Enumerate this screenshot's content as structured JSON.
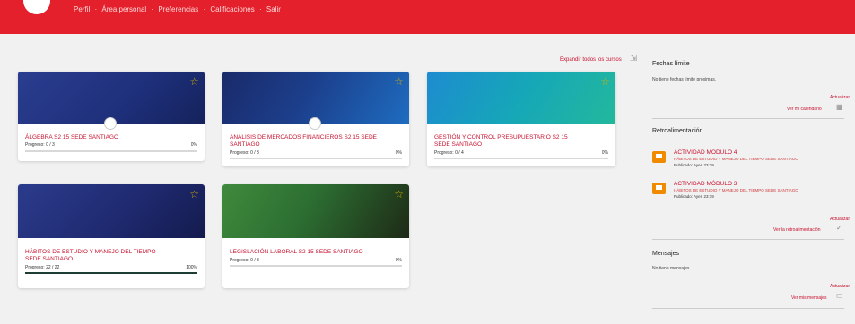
{
  "header": {
    "breadcrumbs": [
      "Perfil",
      "Área personal",
      "Preferencias",
      "Calificaciones",
      "Salir"
    ],
    "separator": "·"
  },
  "main": {
    "expand_label": "Expandir todos los cursos",
    "courses": [
      {
        "title": "ÁLGEBRA S2 15 SEDE SANTIAGO",
        "progress_label": "Progreso: 0 / 3",
        "percent_text": "0%",
        "percent": 0
      },
      {
        "title": "ANÁLISIS DE MERCADOS FINANCIEROS S2 15 SEDE SANTIAGO",
        "progress_label": "Progreso: 0 / 3",
        "percent_text": "0%",
        "percent": 0
      },
      {
        "title": "GESTIÓN Y CONTROL PRESUPUESTARIO S2 15 SEDE SANTIAGO",
        "progress_label": "Progreso: 0 / 4",
        "percent_text": "0%",
        "percent": 0
      },
      {
        "title": "HÁBITOS DE ESTUDIO Y MANEJO DEL TIEMPO SEDE SANTIAGO",
        "progress_label": "Progreso: 22 / 22",
        "percent_text": "100%",
        "percent": 100
      },
      {
        "title": "LEGISLACIÓN LABORAL S2 15 SEDE SANTIAGO",
        "progress_label": "Progreso: 0 / 3",
        "percent_text": "0%",
        "percent": 0
      }
    ]
  },
  "sidebar": {
    "deadlines": {
      "title": "Fechas límite",
      "text": "No tiene fechas límite próximas.",
      "update_label": "Actualizar",
      "view_label": "Ver mi calendario"
    },
    "feedback": {
      "title": "Retroalimentación",
      "items": [
        {
          "name": "ACTIVIDAD MÓDULO 4",
          "course": "HÁBITOS DE ESTUDIO Y MANEJO DEL TIEMPO SEDE SANTIAGO",
          "date": "Publicado: Ayer, 23:19"
        },
        {
          "name": "ACTIVIDAD MÓDULO 3",
          "course": "HÁBITOS DE ESTUDIO Y MANEJO DEL TIEMPO SEDE SANTIAGO",
          "date": "Publicado: Ayer, 23:19"
        }
      ],
      "update_label": "Actualizar",
      "view_label": "Ver la retroalimentación"
    },
    "messages": {
      "title": "Mensajes",
      "text": "No tiene mensajes.",
      "update_label": "Actualizar",
      "view_label": "Ver mis mensajes"
    }
  },
  "colors": {
    "brand_red": "#e3202b",
    "link_red": "#c8102e",
    "feedback_icon": "#f08a00"
  }
}
